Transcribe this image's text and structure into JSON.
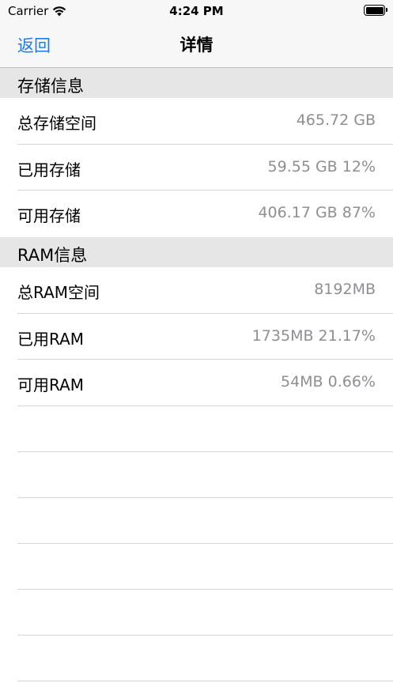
{
  "status_bar": {
    "carrier": "Carrier",
    "time": "4:24 PM"
  },
  "nav": {
    "back_label": "返回",
    "title": "详情"
  },
  "storage": {
    "header": "存储信息",
    "rows": [
      {
        "label": "总存储空间",
        "value": "465.72 GB"
      },
      {
        "label": "已用存储",
        "value": "59.55 GB 12%"
      },
      {
        "label": "可用存储",
        "value": "406.17 GB 87%"
      }
    ]
  },
  "ram": {
    "header": "RAM信息",
    "rows": [
      {
        "label": "总RAM空间",
        "value": "8192MB"
      },
      {
        "label": "已用RAM",
        "value": "1735MB 21.17%"
      },
      {
        "label": "可用RAM",
        "value": "54MB 0.66%"
      }
    ]
  }
}
